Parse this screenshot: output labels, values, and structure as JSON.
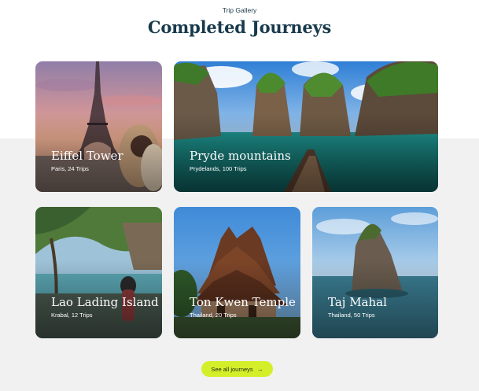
{
  "header": {
    "eyebrow": "Trip Gallery",
    "title": "Completed Journeys"
  },
  "cards": [
    {
      "title": "Eiffel Tower",
      "subtitle": "Paris, 24 Trips"
    },
    {
      "title": "Pryde mountains",
      "subtitle": "Prydelands, 100 Trips"
    },
    {
      "title": "Lao Lading Island",
      "subtitle": "Krabal, 12 Trips"
    },
    {
      "title": "Ton Kwen Temple",
      "subtitle": "Thailand, 20 Trips"
    },
    {
      "title": "Taj Mahal",
      "subtitle": "Thailand, 50 Trips"
    }
  ],
  "cta": {
    "label": "See all journeys",
    "icon": "arrow-right-icon"
  },
  "colors": {
    "accent": "#d4ee2a",
    "heading": "#183a4c",
    "band": "#f1f1f1"
  }
}
